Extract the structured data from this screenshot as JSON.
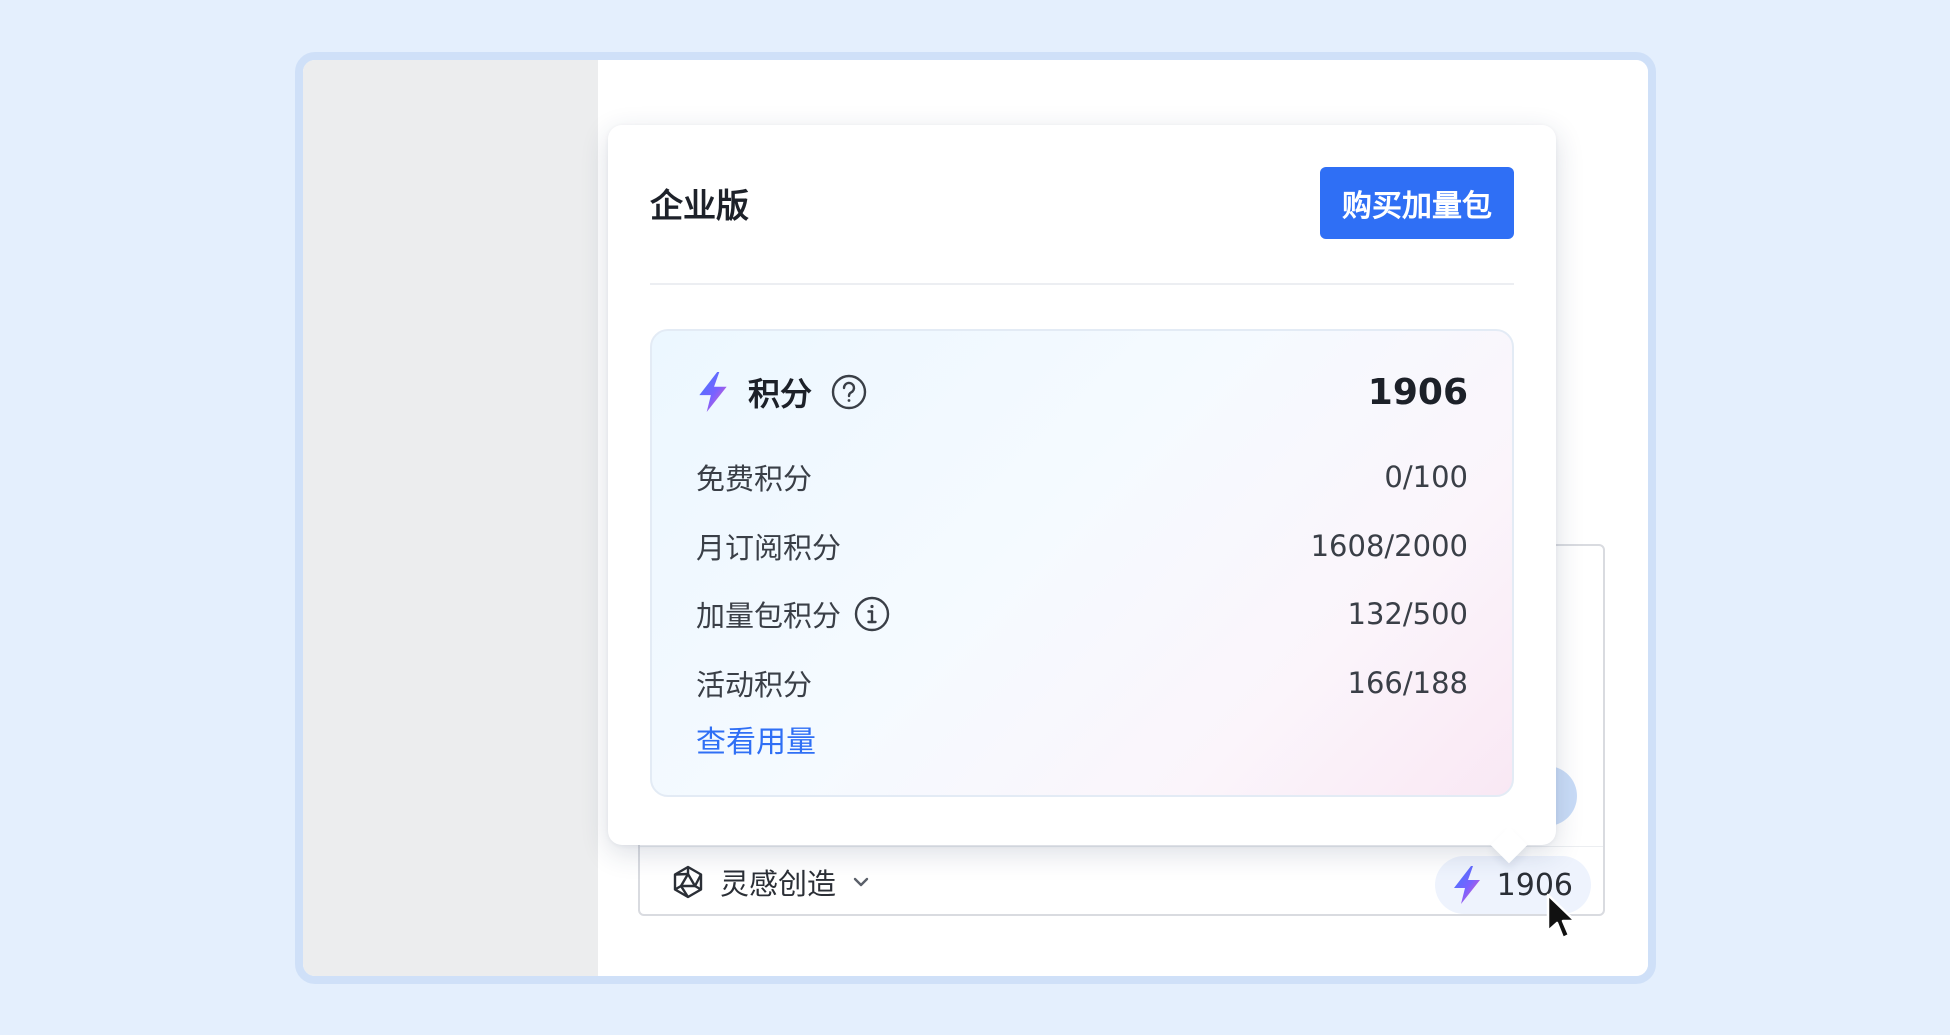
{
  "colors": {
    "background": "#e4effd",
    "accent": "#2f6ff5",
    "sidebar": "#ecedee",
    "text_primary": "#1d2129",
    "text_secondary": "#3a3f47"
  },
  "popover": {
    "plan_name": "企业版",
    "buy_button_label": "购买加量包",
    "credits": {
      "title": "积分",
      "total": "1906",
      "rows": [
        {
          "label": "免费积分",
          "value": "0/100"
        },
        {
          "label": "月订阅积分",
          "value": "1608/2000"
        },
        {
          "label": "加量包积分",
          "value": "132/500"
        },
        {
          "label": "活动积分",
          "value": "166/188"
        }
      ],
      "usage_link": "查看用量"
    }
  },
  "composer": {
    "mode_label": "灵感创造",
    "credit_value": "1906"
  },
  "icons": {
    "bolt": "bolt-icon",
    "help": "help-icon",
    "info": "info-icon",
    "mode": "polyhedron-icon",
    "chevron": "chevron-down-icon",
    "cursor": "mouse-cursor-icon"
  }
}
